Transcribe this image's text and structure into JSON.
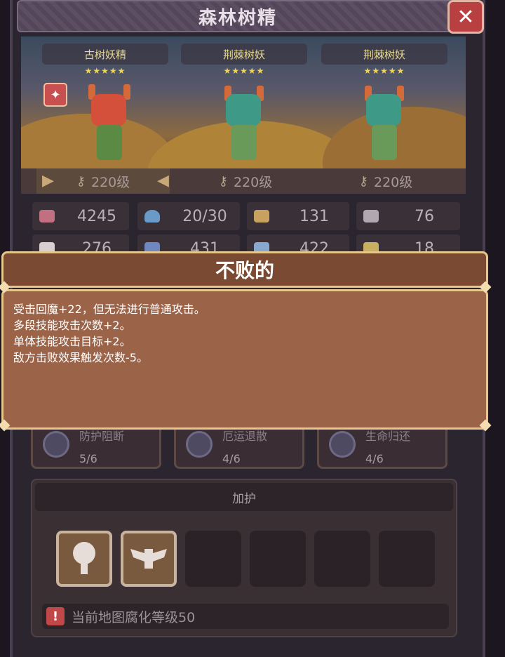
{
  "window": {
    "title": "森林树精",
    "close_label": "✕"
  },
  "team": [
    {
      "name": "古树妖精",
      "stars": "★★★★★",
      "level": "220级"
    },
    {
      "name": "荆棘树妖",
      "stars": "★★★★★",
      "level": "220级"
    },
    {
      "name": "荆棘树妖",
      "stars": "★★★★★",
      "level": "220级"
    }
  ],
  "stats_row1": [
    {
      "icon": "heart-icon",
      "value": "4245"
    },
    {
      "icon": "mana-drop-icon",
      "value": "20/30"
    },
    {
      "icon": "shield-icon",
      "value": "131"
    },
    {
      "icon": "wing-icon",
      "value": "76"
    }
  ],
  "stats_row2": [
    {
      "icon": "book-icon",
      "value": "276"
    },
    {
      "icon": "tome-icon",
      "value": "431"
    },
    {
      "icon": "scroll-icon",
      "value": "422"
    },
    {
      "icon": "claw-icon",
      "value": "18"
    }
  ],
  "popup": {
    "title": "不败的",
    "lines": [
      "受击回魔+22，但无法进行普通攻击。",
      "多段技能攻击次数+2。",
      "单体技能攻击目标+2。",
      "敌方击败效果触发次数-5。"
    ]
  },
  "skills": [
    {
      "name": "防护阻断",
      "progress": "5/6"
    },
    {
      "name": "厄运退散",
      "progress": "4/6"
    },
    {
      "name": "生命归还",
      "progress": "4/6"
    }
  ],
  "buff": {
    "title": "加护",
    "slots": [
      "tree-icon",
      "winged-emblem-icon",
      "",
      "",
      "",
      ""
    ],
    "warning": "当前地图腐化等级50"
  },
  "colors": {
    "accent_gold": "#e8c58a",
    "popup_bg": "#9b6348",
    "close_red": "#b84040"
  }
}
